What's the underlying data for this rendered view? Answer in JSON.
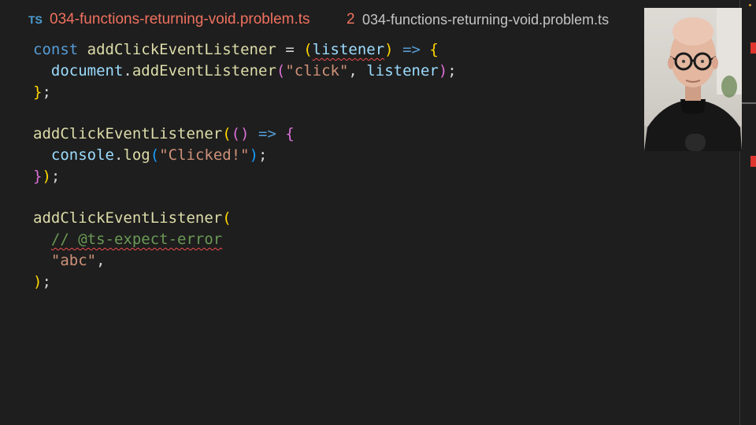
{
  "tab": {
    "file_icon": "TS",
    "title": "034-functions-returning-void.problem.ts",
    "problem_count": "2",
    "path": "034-functions-returning-void.problem.ts"
  },
  "code": {
    "l1": {
      "kw": "const",
      "fn": "addClickEventListener",
      "eq": " = ",
      "open": "(",
      "param": "listener",
      "close": ")",
      "arrow": " => ",
      "brace": "{"
    },
    "l2": {
      "obj": "document",
      "dot": ".",
      "method": "addEventListener",
      "open": "(",
      "arg1": "\"click\"",
      "comma": ", ",
      "arg2": "listener",
      "close": ")",
      "semi": ";"
    },
    "l3": {
      "brace": "}",
      "semi": ";"
    },
    "l5": {
      "fn": "addClickEventListener",
      "open": "(",
      "inner_open": "(",
      "inner_close": ")",
      "arrow": " => ",
      "brace": "{"
    },
    "l6": {
      "obj": "console",
      "dot": ".",
      "method": "log",
      "open": "(",
      "arg": "\"Clicked!\"",
      "close": ")",
      "semi": ";"
    },
    "l7": {
      "brace": "}",
      "close": ")",
      "semi": ";"
    },
    "l9": {
      "fn": "addClickEventListener",
      "open": "("
    },
    "l10": {
      "comment": "// @ts-expect-error"
    },
    "l11": {
      "str": "\"abc\"",
      "comma": ","
    },
    "l12": {
      "close": ")",
      "semi": ";"
    }
  },
  "icons": {
    "file_icon": "typescript-file-icon",
    "webcam": "presenter-webcam-overlay"
  },
  "colors": {
    "background": "#1e1e1e",
    "error": "#f14c4c",
    "keyword": "#569cd6",
    "function": "#dcdcaa",
    "variable": "#9cdcfe",
    "string": "#ce9178",
    "comment": "#6a9955"
  }
}
